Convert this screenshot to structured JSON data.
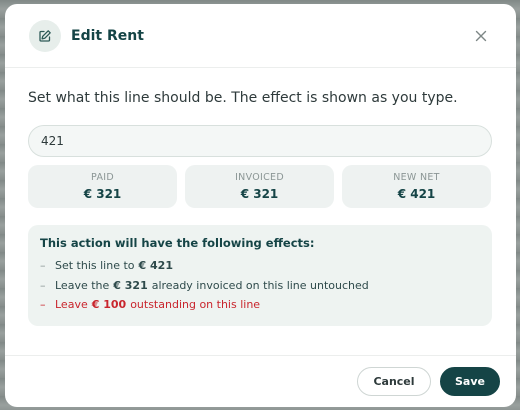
{
  "dialog": {
    "title": "Edit Rent",
    "intro": "Set what this line should be. The effect is shown as you type."
  },
  "input": {
    "value": "421"
  },
  "stats": [
    {
      "label": "PAID",
      "value": "€ 321"
    },
    {
      "label": "INVOICED",
      "value": "€ 321"
    },
    {
      "label": "NEW NET",
      "value": "€ 421"
    }
  ],
  "effects": {
    "title": "This action will have the following effects:",
    "items": [
      {
        "dash": "–",
        "before": "Set this line to",
        "amount": "€ 421",
        "after": ""
      },
      {
        "dash": "–",
        "before": "Leave the",
        "amount": "€ 321",
        "after": "already invoiced on this line untouched"
      },
      {
        "dash": "–",
        "before": "Leave",
        "amount": "€ 100",
        "after": "outstanding on this line"
      }
    ]
  },
  "footer": {
    "cancel_label": "Cancel",
    "save_label": "Save"
  },
  "icons": {
    "header": "edit-pencil-icon",
    "close": "close-icon"
  },
  "colors": {
    "brand": "#154446",
    "warning": "#c9252d",
    "panel": "#eef2f1"
  }
}
